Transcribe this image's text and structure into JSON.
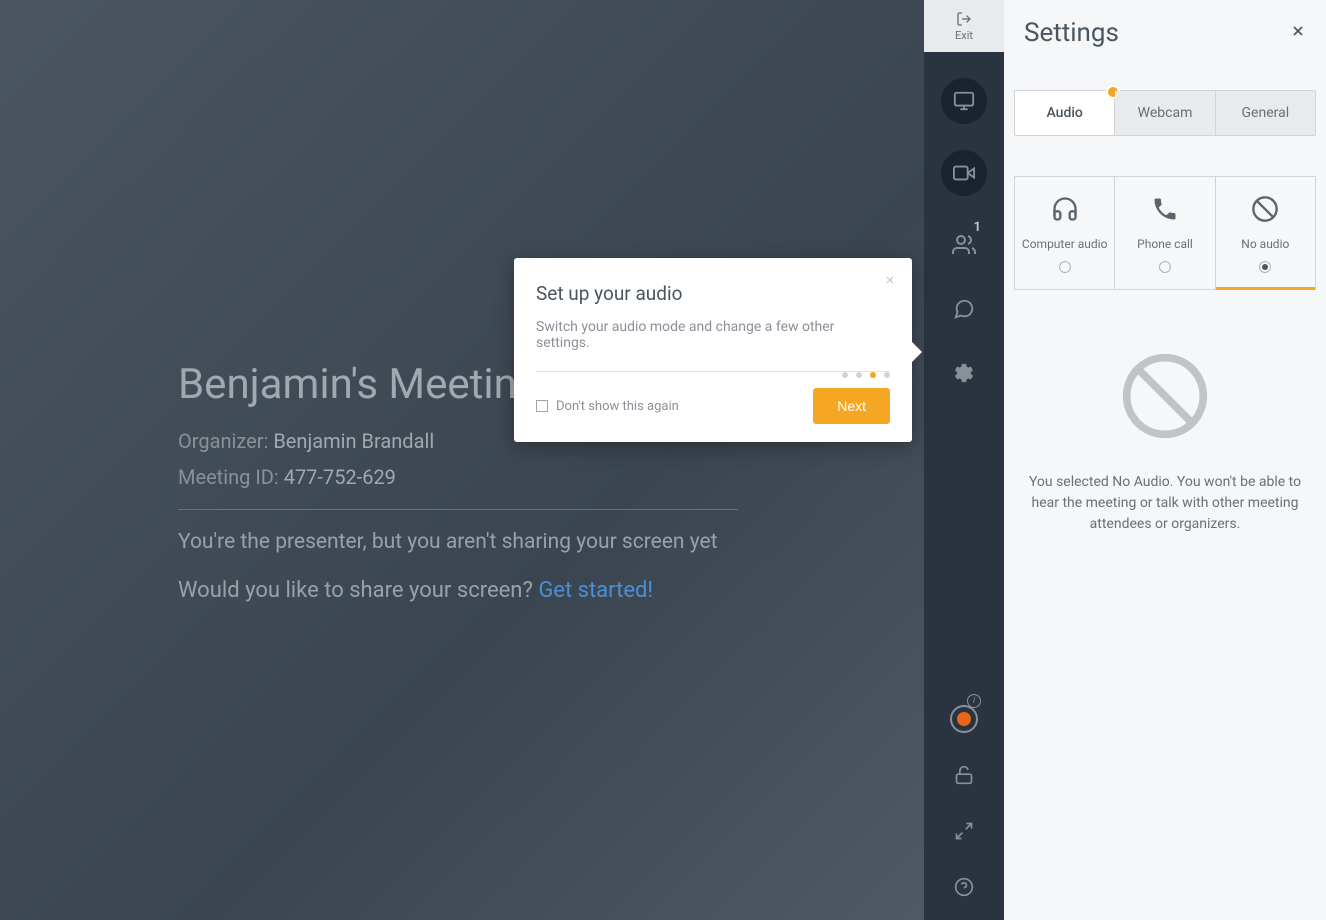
{
  "main": {
    "meeting_title": "Benjamin's Meeting",
    "organizer_label": "Organizer:",
    "organizer_name": "Benjamin Brandall",
    "meeting_id_label": "Meeting ID:",
    "meeting_id_value": "477-752-629",
    "presenter_message": "You're the presenter, but you aren't sharing your screen yet",
    "share_prompt": "Would you like to share your screen? ",
    "get_started_link": "Get started!"
  },
  "sidebar": {
    "exit_label": "Exit",
    "people_count": "1"
  },
  "settings": {
    "title": "Settings",
    "tabs": {
      "audio": "Audio",
      "webcam": "Webcam",
      "general": "General"
    },
    "audio_options": {
      "computer": "Computer audio",
      "phone": "Phone call",
      "none": "No audio"
    },
    "no_audio_message": "You selected No Audio. You won't be able to hear the meeting or talk with other meeting attendees or organizers."
  },
  "tooltip": {
    "title": "Set up your audio",
    "description": "Switch your audio mode and change a few other settings.",
    "dont_show_label": "Don't show this again",
    "next_button": "Next"
  }
}
